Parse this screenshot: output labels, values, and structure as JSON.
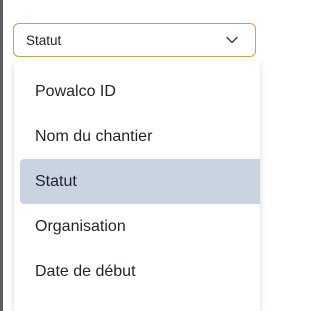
{
  "select": {
    "value": "Statut",
    "icon": "chevron-down-icon",
    "border_color": "#c9a24a"
  },
  "menu": {
    "items": [
      {
        "label": "Powalco ID",
        "selected": false
      },
      {
        "label": "Nom du chantier",
        "selected": false
      },
      {
        "label": "Statut",
        "selected": true
      },
      {
        "label": "Organisation",
        "selected": false
      },
      {
        "label": "Date de début",
        "selected": false
      }
    ],
    "selected_color": "#c9d3e1"
  }
}
